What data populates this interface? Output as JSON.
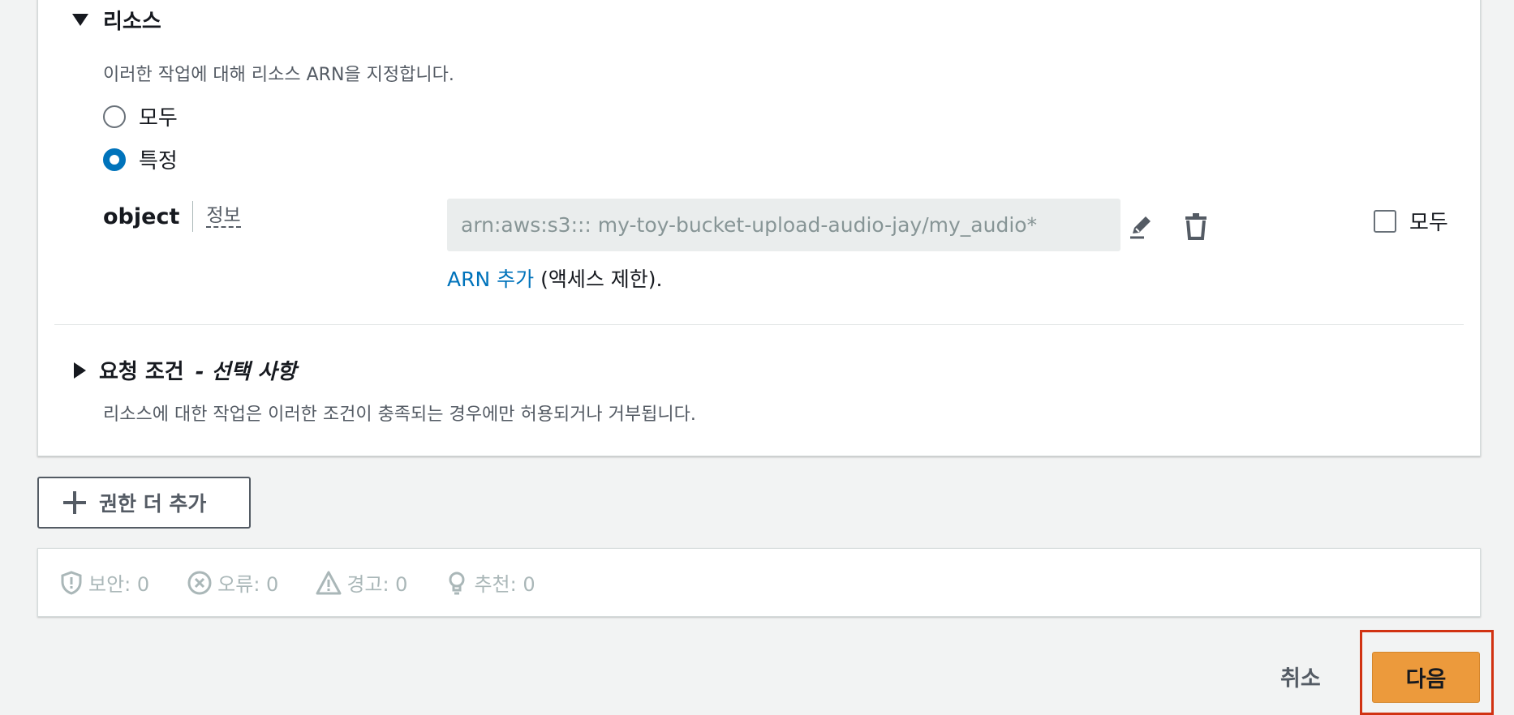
{
  "resources": {
    "heading": "리소스",
    "description": "이러한 작업에 대해 리소스 ARN을 지정합니다.",
    "options": [
      "모두",
      "특정"
    ],
    "selected": "특정",
    "resource_type": "object",
    "info_label": "정보",
    "arn_value": "arn:aws:s3::: my-toy-bucket-upload-audio-jay/my_audio*",
    "all_label": "모두",
    "add_arn_link": "ARN 추가",
    "add_arn_suffix": " (액세스 제한)."
  },
  "request_conditions": {
    "heading": "요청 조건",
    "optional": "- 선택 사항",
    "description": "리소스에 대한 작업은 이러한 조건이 충족되는 경우에만 허용되거나 거부됩니다."
  },
  "add_permission_label": "권한 더 추가",
  "status": {
    "security": "보안: 0",
    "errors": "오류: 0",
    "warnings": "경고: 0",
    "suggestions": "추천: 0"
  },
  "footer": {
    "cancel_label": "취소",
    "next_label": "다음"
  },
  "colors": {
    "accent": "#0073bb",
    "primary_button": "#ec9a3c",
    "highlight": "#d13212"
  }
}
